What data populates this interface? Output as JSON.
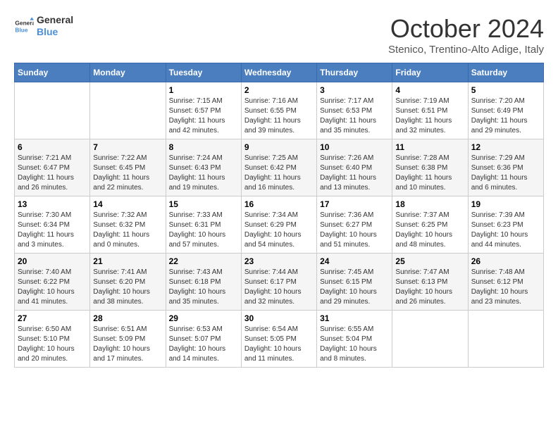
{
  "header": {
    "logo": {
      "general": "General",
      "blue": "Blue"
    },
    "title": "October 2024",
    "subtitle": "Stenico, Trentino-Alto Adige, Italy"
  },
  "calendar": {
    "days_of_week": [
      "Sunday",
      "Monday",
      "Tuesday",
      "Wednesday",
      "Thursday",
      "Friday",
      "Saturday"
    ],
    "weeks": [
      [
        {
          "day": "",
          "info": ""
        },
        {
          "day": "",
          "info": ""
        },
        {
          "day": "1",
          "info": "Sunrise: 7:15 AM\nSunset: 6:57 PM\nDaylight: 11 hours and 42 minutes."
        },
        {
          "day": "2",
          "info": "Sunrise: 7:16 AM\nSunset: 6:55 PM\nDaylight: 11 hours and 39 minutes."
        },
        {
          "day": "3",
          "info": "Sunrise: 7:17 AM\nSunset: 6:53 PM\nDaylight: 11 hours and 35 minutes."
        },
        {
          "day": "4",
          "info": "Sunrise: 7:19 AM\nSunset: 6:51 PM\nDaylight: 11 hours and 32 minutes."
        },
        {
          "day": "5",
          "info": "Sunrise: 7:20 AM\nSunset: 6:49 PM\nDaylight: 11 hours and 29 minutes."
        }
      ],
      [
        {
          "day": "6",
          "info": "Sunrise: 7:21 AM\nSunset: 6:47 PM\nDaylight: 11 hours and 26 minutes."
        },
        {
          "day": "7",
          "info": "Sunrise: 7:22 AM\nSunset: 6:45 PM\nDaylight: 11 hours and 22 minutes."
        },
        {
          "day": "8",
          "info": "Sunrise: 7:24 AM\nSunset: 6:43 PM\nDaylight: 11 hours and 19 minutes."
        },
        {
          "day": "9",
          "info": "Sunrise: 7:25 AM\nSunset: 6:42 PM\nDaylight: 11 hours and 16 minutes."
        },
        {
          "day": "10",
          "info": "Sunrise: 7:26 AM\nSunset: 6:40 PM\nDaylight: 11 hours and 13 minutes."
        },
        {
          "day": "11",
          "info": "Sunrise: 7:28 AM\nSunset: 6:38 PM\nDaylight: 11 hours and 10 minutes."
        },
        {
          "day": "12",
          "info": "Sunrise: 7:29 AM\nSunset: 6:36 PM\nDaylight: 11 hours and 6 minutes."
        }
      ],
      [
        {
          "day": "13",
          "info": "Sunrise: 7:30 AM\nSunset: 6:34 PM\nDaylight: 11 hours and 3 minutes."
        },
        {
          "day": "14",
          "info": "Sunrise: 7:32 AM\nSunset: 6:32 PM\nDaylight: 11 hours and 0 minutes."
        },
        {
          "day": "15",
          "info": "Sunrise: 7:33 AM\nSunset: 6:31 PM\nDaylight: 10 hours and 57 minutes."
        },
        {
          "day": "16",
          "info": "Sunrise: 7:34 AM\nSunset: 6:29 PM\nDaylight: 10 hours and 54 minutes."
        },
        {
          "day": "17",
          "info": "Sunrise: 7:36 AM\nSunset: 6:27 PM\nDaylight: 10 hours and 51 minutes."
        },
        {
          "day": "18",
          "info": "Sunrise: 7:37 AM\nSunset: 6:25 PM\nDaylight: 10 hours and 48 minutes."
        },
        {
          "day": "19",
          "info": "Sunrise: 7:39 AM\nSunset: 6:23 PM\nDaylight: 10 hours and 44 minutes."
        }
      ],
      [
        {
          "day": "20",
          "info": "Sunrise: 7:40 AM\nSunset: 6:22 PM\nDaylight: 10 hours and 41 minutes."
        },
        {
          "day": "21",
          "info": "Sunrise: 7:41 AM\nSunset: 6:20 PM\nDaylight: 10 hours and 38 minutes."
        },
        {
          "day": "22",
          "info": "Sunrise: 7:43 AM\nSunset: 6:18 PM\nDaylight: 10 hours and 35 minutes."
        },
        {
          "day": "23",
          "info": "Sunrise: 7:44 AM\nSunset: 6:17 PM\nDaylight: 10 hours and 32 minutes."
        },
        {
          "day": "24",
          "info": "Sunrise: 7:45 AM\nSunset: 6:15 PM\nDaylight: 10 hours and 29 minutes."
        },
        {
          "day": "25",
          "info": "Sunrise: 7:47 AM\nSunset: 6:13 PM\nDaylight: 10 hours and 26 minutes."
        },
        {
          "day": "26",
          "info": "Sunrise: 7:48 AM\nSunset: 6:12 PM\nDaylight: 10 hours and 23 minutes."
        }
      ],
      [
        {
          "day": "27",
          "info": "Sunrise: 6:50 AM\nSunset: 5:10 PM\nDaylight: 10 hours and 20 minutes."
        },
        {
          "day": "28",
          "info": "Sunrise: 6:51 AM\nSunset: 5:09 PM\nDaylight: 10 hours and 17 minutes."
        },
        {
          "day": "29",
          "info": "Sunrise: 6:53 AM\nSunset: 5:07 PM\nDaylight: 10 hours and 14 minutes."
        },
        {
          "day": "30",
          "info": "Sunrise: 6:54 AM\nSunset: 5:05 PM\nDaylight: 10 hours and 11 minutes."
        },
        {
          "day": "31",
          "info": "Sunrise: 6:55 AM\nSunset: 5:04 PM\nDaylight: 10 hours and 8 minutes."
        },
        {
          "day": "",
          "info": ""
        },
        {
          "day": "",
          "info": ""
        }
      ]
    ]
  }
}
